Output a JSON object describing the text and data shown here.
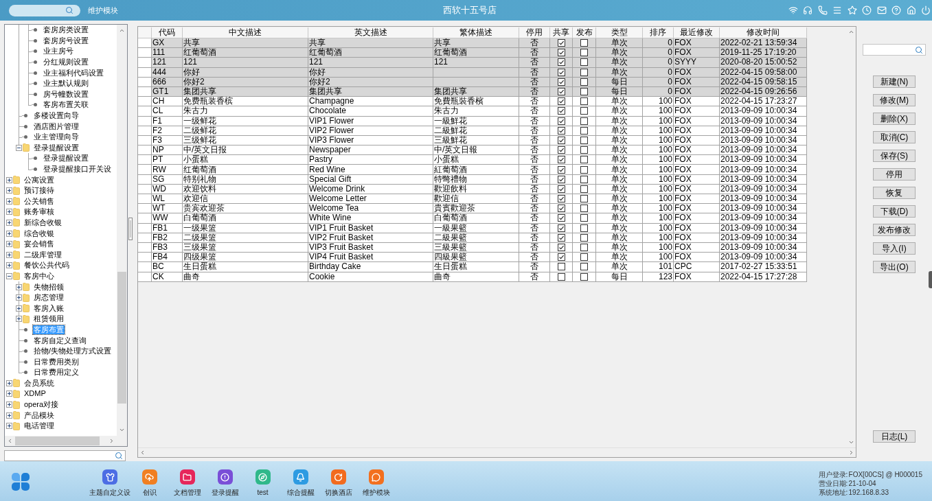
{
  "header": {
    "module_label": "维护模块",
    "title": "西软十五号店"
  },
  "tree": [
    {
      "children": [
        {
          "children": [
            {
              "label": "套房房类设置",
              "kind": "leaf",
              "selected": false
            },
            {
              "label": "套房房号设置",
              "kind": "leaf",
              "selected": false
            },
            {
              "label": "业主房号",
              "kind": "leaf",
              "selected": false
            },
            {
              "label": "分红规则设置",
              "kind": "leaf",
              "selected": false
            },
            {
              "label": "业主福利代码设置",
              "kind": "leaf",
              "selected": false
            },
            {
              "label": "业主默认规则",
              "kind": "leaf",
              "selected": false
            },
            {
              "label": "房号幢数设置",
              "kind": "leaf",
              "selected": false
            },
            {
              "label": "客房布置关联",
              "kind": "leaf",
              "selected": false
            }
          ]
        },
        {
          "label": "多楼设置向导",
          "kind": "leaf",
          "selected": false
        },
        {
          "label": "酒店图片管理",
          "kind": "leaf",
          "selected": false
        },
        {
          "label": "业主管理向导",
          "kind": "leaf",
          "selected": false
        },
        {
          "label": "登录提醒设置",
          "kind": "folder",
          "expanded": true,
          "selected": false,
          "children": [
            {
              "label": "登录提醒设置",
              "kind": "leaf",
              "selected": false
            },
            {
              "label": "登录提醒接口开关设",
              "kind": "leaf",
              "selected": false
            }
          ]
        }
      ]
    },
    {
      "label": "公寓设置",
      "kind": "folder",
      "expanded": false,
      "selected": false
    },
    {
      "label": "预订接待",
      "kind": "folder",
      "expanded": false,
      "selected": false
    },
    {
      "label": "公关销售",
      "kind": "folder",
      "expanded": false,
      "selected": false
    },
    {
      "label": "账务审核",
      "kind": "folder",
      "expanded": false,
      "selected": false
    },
    {
      "label": "新综合收银",
      "kind": "folder",
      "expanded": false,
      "selected": false
    },
    {
      "label": "综合收银",
      "kind": "folder",
      "expanded": false,
      "selected": false
    },
    {
      "label": "宴会销售",
      "kind": "folder",
      "expanded": false,
      "selected": false
    },
    {
      "label": "二级库管理",
      "kind": "folder",
      "expanded": false,
      "selected": false
    },
    {
      "label": "餐饮公共代码",
      "kind": "folder",
      "expanded": false,
      "selected": false
    },
    {
      "label": "客房中心",
      "kind": "folder",
      "expanded": true,
      "selected": false,
      "children": [
        {
          "label": "失物招领",
          "kind": "folder",
          "expanded": false,
          "selected": false
        },
        {
          "label": "房态管理",
          "kind": "folder",
          "expanded": false,
          "selected": false
        },
        {
          "label": "客房入账",
          "kind": "folder",
          "expanded": false,
          "selected": false
        },
        {
          "label": "租赁领用",
          "kind": "folder",
          "expanded": false,
          "selected": false
        },
        {
          "label": "客房布置",
          "kind": "leaf",
          "selected": true
        },
        {
          "label": "客房自定义查询",
          "kind": "leaf",
          "selected": false
        },
        {
          "label": "拾物/失物处理方式设置",
          "kind": "leaf",
          "selected": false
        },
        {
          "label": "日常费用类别",
          "kind": "leaf",
          "selected": false
        },
        {
          "label": "日常费用定义",
          "kind": "leaf",
          "selected": false
        }
      ]
    },
    {
      "label": "会员系统",
      "kind": "folder",
      "expanded": false,
      "selected": false
    },
    {
      "label": "XDMP",
      "kind": "folder",
      "expanded": false,
      "selected": false
    },
    {
      "label": "opera对接",
      "kind": "folder",
      "expanded": false,
      "selected": false
    },
    {
      "label": "产品模块",
      "kind": "folder",
      "expanded": false,
      "selected": false
    },
    {
      "label": "电话管理",
      "kind": "folder",
      "expanded": false,
      "selected": false
    }
  ],
  "table": {
    "columns": [
      "代码",
      "中文描述",
      "英文描述",
      "繁体描述",
      "停用",
      "共享",
      "发布",
      "类型",
      "排序",
      "最近修改",
      "修改时间"
    ],
    "rows": [
      {
        "shaded": true,
        "code": "GX",
        "chinese": "共享",
        "english": "共享",
        "traditional": "共享",
        "disabled": "否",
        "shared": true,
        "published": false,
        "type": "单次",
        "order": "0",
        "modified_by": "FOX",
        "modified_at": "2022-02-21 13:59:34"
      },
      {
        "shaded": true,
        "code": "111",
        "chinese": "红葡萄酒",
        "english": "红葡萄酒",
        "traditional": "红葡萄酒",
        "disabled": "否",
        "shared": true,
        "published": false,
        "type": "单次",
        "order": "0",
        "modified_by": "FOX",
        "modified_at": "2019-11-25 17:19:20"
      },
      {
        "shaded": true,
        "code": "121",
        "chinese": "121",
        "english": "121",
        "traditional": "121",
        "disabled": "否",
        "shared": true,
        "published": false,
        "type": "单次",
        "order": "0",
        "modified_by": "SYYY",
        "modified_at": "2020-08-20 15:00:52"
      },
      {
        "shaded": true,
        "code": "444",
        "chinese": "你好",
        "english": "你好",
        "disabled": "否",
        "shared": true,
        "published": false,
        "type": "单次",
        "order": "0",
        "modified_by": "FOX",
        "modified_at": "2022-04-15 09:58:00"
      },
      {
        "shaded": true,
        "code": "666",
        "chinese": "你好2",
        "english": "你好2",
        "disabled": "否",
        "shared": true,
        "published": false,
        "type": "每日",
        "order": "0",
        "modified_by": "FOX",
        "modified_at": "2022-04-15 09:58:15"
      },
      {
        "shaded": true,
        "code": "GT1",
        "chinese": "集团共享",
        "english": "集团共享",
        "traditional": "集团共享",
        "disabled": "否",
        "shared": true,
        "published": false,
        "type": "每日",
        "order": "0",
        "modified_by": "FOX",
        "modified_at": "2022-04-15 09:26:56"
      },
      {
        "shaded": false,
        "code": "CH",
        "chinese": "免费瓶装香槟",
        "english": "Champagne",
        "traditional": "免費瓶裝香檳",
        "disabled": "否",
        "shared": true,
        "published": false,
        "type": "单次",
        "order": "100",
        "modified_by": "FOX",
        "modified_at": "2022-04-15 17:23:27"
      },
      {
        "shaded": false,
        "code": "CL",
        "chinese": "朱古力",
        "english": "Chocolate",
        "traditional": "朱古力",
        "disabled": "否",
        "shared": true,
        "published": false,
        "type": "单次",
        "order": "100",
        "modified_by": "FOX",
        "modified_at": "2013-09-09 10:00:34"
      },
      {
        "shaded": false,
        "code": "F1",
        "chinese": "一级鲜花",
        "english": "VIP1 Flower",
        "traditional": "一級鮮花",
        "disabled": "否",
        "shared": true,
        "published": false,
        "type": "单次",
        "order": "100",
        "modified_by": "FOX",
        "modified_at": "2013-09-09 10:00:34"
      },
      {
        "shaded": false,
        "code": "F2",
        "chinese": "二级鲜花",
        "english": "VIP2 Flower",
        "traditional": "二級鮮花",
        "disabled": "否",
        "shared": true,
        "published": false,
        "type": "单次",
        "order": "100",
        "modified_by": "FOX",
        "modified_at": "2013-09-09 10:00:34"
      },
      {
        "shaded": false,
        "code": "F3",
        "chinese": "三级鲜花",
        "english": "VIP3 Flower",
        "traditional": "三級鮮花",
        "disabled": "否",
        "shared": true,
        "published": false,
        "type": "单次",
        "order": "100",
        "modified_by": "FOX",
        "modified_at": "2013-09-09 10:00:34"
      },
      {
        "shaded": false,
        "code": "NP",
        "chinese": "中/英文日报",
        "english": "Newspaper",
        "traditional": "中/英文日報",
        "disabled": "否",
        "shared": true,
        "published": false,
        "type": "单次",
        "order": "100",
        "modified_by": "FOX",
        "modified_at": "2013-09-09 10:00:34"
      },
      {
        "shaded": false,
        "code": "PT",
        "chinese": "小蛋糕",
        "english": "Pastry",
        "traditional": "小蛋糕",
        "disabled": "否",
        "shared": true,
        "published": false,
        "type": "单次",
        "order": "100",
        "modified_by": "FOX",
        "modified_at": "2013-09-09 10:00:34"
      },
      {
        "shaded": false,
        "code": "RW",
        "chinese": "红葡萄酒",
        "english": "Red Wine",
        "traditional": "紅葡萄酒",
        "disabled": "否",
        "shared": true,
        "published": false,
        "type": "单次",
        "order": "100",
        "modified_by": "FOX",
        "modified_at": "2013-09-09 10:00:34"
      },
      {
        "shaded": false,
        "code": "SG",
        "chinese": "特别礼物",
        "english": "Special Gift",
        "traditional": "特彆禮物",
        "disabled": "否",
        "shared": true,
        "published": false,
        "type": "单次",
        "order": "100",
        "modified_by": "FOX",
        "modified_at": "2013-09-09 10:00:34"
      },
      {
        "shaded": false,
        "code": "WD",
        "chinese": "欢迎饮料",
        "english": "Welcome Drink",
        "traditional": "歡迎飲料",
        "disabled": "否",
        "shared": true,
        "published": false,
        "type": "单次",
        "order": "100",
        "modified_by": "FOX",
        "modified_at": "2013-09-09 10:00:34"
      },
      {
        "shaded": false,
        "code": "WL",
        "chinese": "欢迎信",
        "english": "Welcome Letter",
        "traditional": "歡迎信",
        "disabled": "否",
        "shared": true,
        "published": false,
        "type": "单次",
        "order": "100",
        "modified_by": "FOX",
        "modified_at": "2013-09-09 10:00:34"
      },
      {
        "shaded": false,
        "code": "WT",
        "chinese": "贵宾欢迎茶",
        "english": "Welcome Tea",
        "traditional": "貴賓歡迎茶",
        "disabled": "否",
        "shared": true,
        "published": false,
        "type": "单次",
        "order": "100",
        "modified_by": "FOX",
        "modified_at": "2013-09-09 10:00:34"
      },
      {
        "shaded": false,
        "code": "WW",
        "chinese": "白葡萄酒",
        "english": "White Wine",
        "traditional": "白葡萄酒",
        "disabled": "否",
        "shared": true,
        "published": false,
        "type": "单次",
        "order": "100",
        "modified_by": "FOX",
        "modified_at": "2013-09-09 10:00:34"
      },
      {
        "shaded": false,
        "code": "FB1",
        "chinese": "一级果篮",
        "english": "VIP1 Fruit Basket",
        "traditional": "一級果籃",
        "disabled": "否",
        "shared": true,
        "published": false,
        "type": "单次",
        "order": "100",
        "modified_by": "FOX",
        "modified_at": "2013-09-09 10:00:34"
      },
      {
        "shaded": false,
        "code": "FB2",
        "chinese": "二级果篮",
        "english": "VIP2 Fruit Basket",
        "traditional": "二級果籃",
        "disabled": "否",
        "shared": true,
        "published": false,
        "type": "单次",
        "order": "100",
        "modified_by": "FOX",
        "modified_at": "2013-09-09 10:00:34"
      },
      {
        "shaded": false,
        "code": "FB3",
        "chinese": "三级果篮",
        "english": "VIP3 Fruit Basket",
        "traditional": "三級果籃",
        "disabled": "否",
        "shared": true,
        "published": false,
        "type": "单次",
        "order": "100",
        "modified_by": "FOX",
        "modified_at": "2013-09-09 10:00:34"
      },
      {
        "shaded": false,
        "code": "FB4",
        "chinese": "四级果篮",
        "english": "VIP4 Fruit Basket",
        "traditional": "四級果籃",
        "disabled": "否",
        "shared": true,
        "published": false,
        "type": "单次",
        "order": "100",
        "modified_by": "FOX",
        "modified_at": "2013-09-09 10:00:34"
      },
      {
        "shaded": false,
        "code": "BC",
        "chinese": "生日蛋糕",
        "english": "Birthday Cake",
        "traditional": "生日蛋糕",
        "disabled": "否",
        "shared": false,
        "published": false,
        "type": "单次",
        "order": "101",
        "modified_by": "CPC",
        "modified_at": "2017-02-27 15:33:51"
      },
      {
        "shaded": false,
        "code": "CK",
        "chinese": "曲奇",
        "english": "Cookie",
        "traditional": "曲奇",
        "disabled": "否",
        "shared": false,
        "published": false,
        "type": "每日",
        "order": "123",
        "modified_by": "FOX",
        "modified_at": "2022-04-15 17:27:28"
      }
    ]
  },
  "actions": [
    "新建(N)",
    "修改(M)",
    "删除(X)",
    "取消(C)",
    "保存(S)",
    "停用",
    "恢复",
    "下载(D)",
    "发布修改",
    "导入(I)",
    "导出(O)"
  ],
  "log_button": "日志(L)",
  "dock": [
    {
      "label": "主题自定义设",
      "kind": "shirt",
      "color": "#4c6de4"
    },
    {
      "label": "创识",
      "kind": "cloud",
      "color": "#f07f22"
    },
    {
      "label": "文档管理",
      "kind": "folder",
      "color": "#e6265b"
    },
    {
      "label": "登录提醒",
      "kind": "alert",
      "color": "#7a4fd7"
    },
    {
      "label": "test",
      "kind": "compass",
      "color": "#2fb88a"
    },
    {
      "label": "综合提醒",
      "kind": "bell",
      "color": "#2d9be2"
    },
    {
      "label": "切换酒店",
      "kind": "refresh",
      "color": "#f26b1e"
    },
    {
      "label": "维护模块",
      "kind": "chat",
      "color": "#f2701f"
    }
  ],
  "status": [
    {
      "label": "用户登录:",
      "value": "FOX[00CS] @ H000015"
    },
    {
      "label": "营业日期:",
      "value": "21-10-04"
    },
    {
      "label": "系统地址:",
      "value": "192.168.8.33"
    }
  ]
}
